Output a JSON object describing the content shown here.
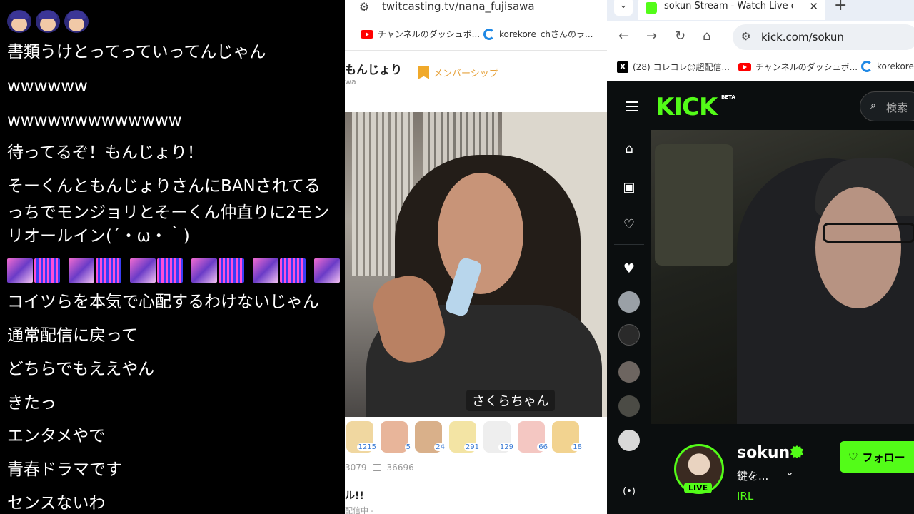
{
  "chat": {
    "lines": [
      "書類うけとってっていってんじゃん",
      "wwwwww",
      "wwwwwwwwwwwww",
      "待ってるぞ！もんじょり！",
      "そーくんともんじょりさんにBANされてる",
      "っちでモンジョリとそーくん仲直りに2モン",
      "リオールイン(´・ω・｀)",
      "コイツらを本気で心配するわけないじゃん",
      "通常配信に戻って",
      "どちらでもええやん",
      "きたっ",
      "エンタメやで",
      "青春ドラマです",
      "センスないわ"
    ]
  },
  "twitcasting": {
    "url": "twitcasting.tv/nana_fujisawa",
    "bookmarks": [
      "チャンネルのダッシュボ...",
      "korekore_chさんのラ..."
    ],
    "channel_name": "もんじょり",
    "channel_sub": "wa",
    "membership_label": "メンバーシップ",
    "caption": "さくらちゃん",
    "gift_counts": [
      "1215",
      "5",
      "24",
      "291",
      "129",
      "66",
      "18"
    ],
    "viewers": "3079",
    "comments": "36696",
    "title_fragment": "ル!!",
    "status": "配信中 -"
  },
  "kick_browser": {
    "tab_title": "sokun Stream - Watch Live on K",
    "url": "kick.com/sokun",
    "bookmarks": [
      "(28) コレコレ@超配信...",
      "チャンネルのダッシュボ...",
      "korekore"
    ],
    "logo_text": "KICK",
    "beta_label": "BETA",
    "search_label": "検索",
    "username": "sokun",
    "stream_title": "鍵を...",
    "category": "IRL",
    "live_label": "LIVE",
    "follow_label": "フォロー",
    "accent_color": "#53fc18"
  }
}
